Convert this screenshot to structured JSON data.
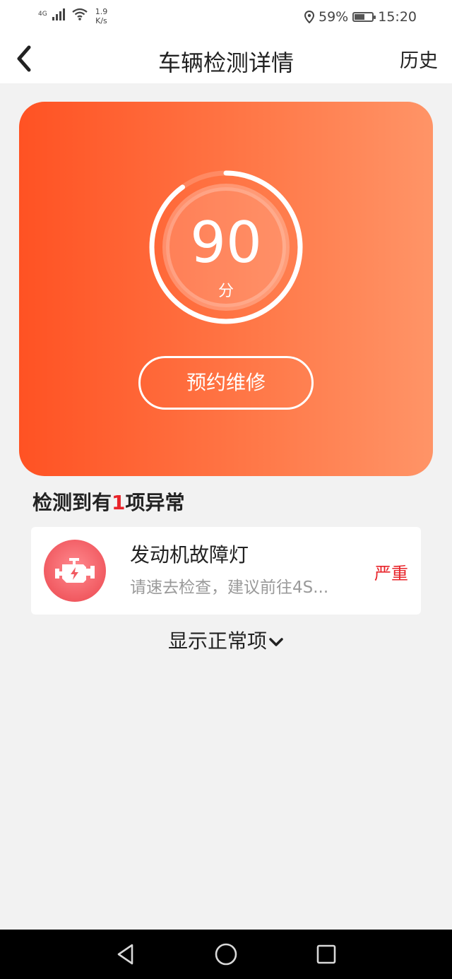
{
  "status_bar": {
    "network": "4G",
    "speed_value": "1.9",
    "speed_unit": "K/s",
    "battery_percent": "59%",
    "battery_level": 0.59,
    "time": "15:20"
  },
  "navbar": {
    "title": "车辆检测详情",
    "history_label": "历史"
  },
  "score_card": {
    "score": "90",
    "score_unit": "分",
    "score_fraction": 0.9,
    "book_button_label": "预约维修"
  },
  "abnormal": {
    "heading_prefix": "检测到有",
    "count": "1",
    "heading_suffix": "项异常",
    "items": [
      {
        "name": "发动机故障灯",
        "description": "请速去检查，建议前往4S...",
        "severity": "严重"
      }
    ]
  },
  "show_normal_label": "显示正常项",
  "colors": {
    "accent_start": "#ff5223",
    "accent_end": "#ff9467",
    "danger": "#e8242a",
    "icon_bg": "#f15a61"
  }
}
